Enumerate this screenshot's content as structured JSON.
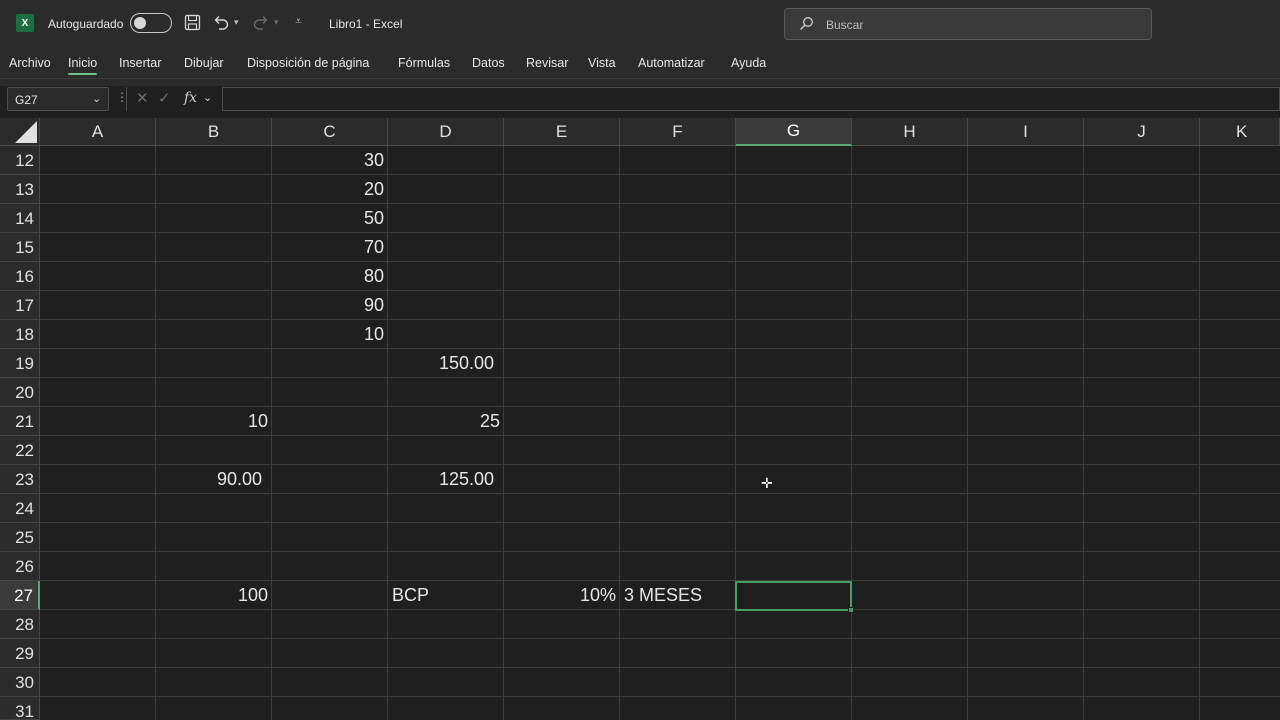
{
  "titlebar": {
    "app_logo": "X",
    "autosave_label": "Autoguardado",
    "doc_title": "Libro1  -  Excel",
    "search_placeholder": "Buscar",
    "icons": [
      "save-icon",
      "undo-icon",
      "redo-icon",
      "customize-toolbar-icon"
    ]
  },
  "ribbon": {
    "tabs": [
      "Archivo",
      "Inicio",
      "Insertar",
      "Dibujar",
      "Disposición de página",
      "Fórmulas",
      "Datos",
      "Revisar",
      "Vista",
      "Automatizar",
      "Ayuda"
    ],
    "active_tab": "Inicio"
  },
  "formula_bar": {
    "name_box": "G27",
    "cancel_icon": "✕",
    "enter_icon": "✓",
    "function_icon": "fx",
    "formula_value": ""
  },
  "sheet": {
    "columns": [
      "A",
      "B",
      "C",
      "D",
      "E",
      "F",
      "G",
      "H",
      "I",
      "J",
      "K"
    ],
    "selected_column": "G",
    "rows": [
      "12",
      "13",
      "14",
      "15",
      "16",
      "17",
      "18",
      "19",
      "20",
      "21",
      "22",
      "23",
      "24",
      "25",
      "26",
      "27",
      "28",
      "29",
      "30",
      "31"
    ],
    "selected_row": "27",
    "cells": {
      "C12": "30",
      "C13": "20",
      "C14": "50",
      "C15": "70",
      "C16": "80",
      "C17": "90",
      "C18": "10",
      "D19": "150.00",
      "B21": "10",
      "D21": "25",
      "B23": "90.00",
      "D23": "125.00",
      "B27": "100",
      "D27": "BCP",
      "E27": "10%",
      "F27": "3 MESES"
    },
    "active_cell": "G27",
    "accent_color": "#4d9a63"
  }
}
